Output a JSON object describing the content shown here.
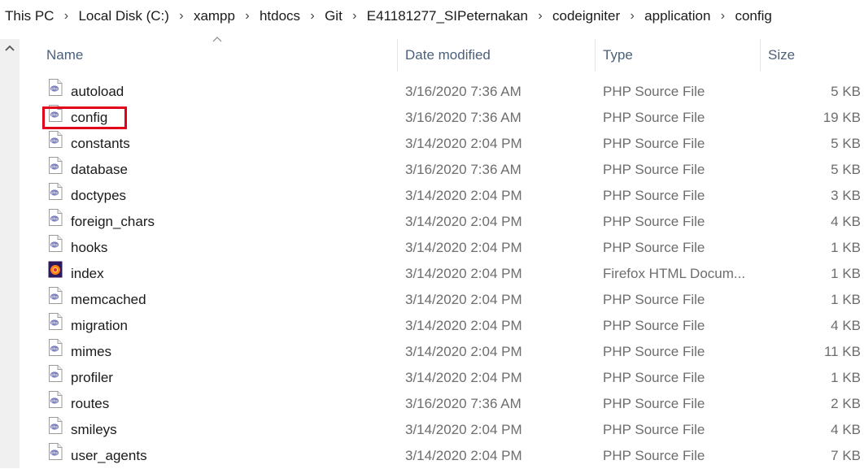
{
  "breadcrumb": [
    "This PC",
    "Local Disk (C:)",
    "xampp",
    "htdocs",
    "Git",
    "E41181277_SIPeternakan",
    "codeigniter",
    "application",
    "config"
  ],
  "columns": {
    "name": "Name",
    "date": "Date modified",
    "type": "Type",
    "size": "Size"
  },
  "files": [
    {
      "name": "autoload",
      "date": "3/16/2020 7:36 AM",
      "type": "PHP Source File",
      "size": "5 KB",
      "icon": "php-file-icon"
    },
    {
      "name": "config",
      "date": "3/16/2020 7:36 AM",
      "type": "PHP Source File",
      "size": "19 KB",
      "icon": "php-file-icon",
      "highlighted": true
    },
    {
      "name": "constants",
      "date": "3/14/2020 2:04 PM",
      "type": "PHP Source File",
      "size": "5 KB",
      "icon": "php-file-icon"
    },
    {
      "name": "database",
      "date": "3/16/2020 7:36 AM",
      "type": "PHP Source File",
      "size": "5 KB",
      "icon": "php-file-icon"
    },
    {
      "name": "doctypes",
      "date": "3/14/2020 2:04 PM",
      "type": "PHP Source File",
      "size": "3 KB",
      "icon": "php-file-icon"
    },
    {
      "name": "foreign_chars",
      "date": "3/14/2020 2:04 PM",
      "type": "PHP Source File",
      "size": "4 KB",
      "icon": "php-file-icon"
    },
    {
      "name": "hooks",
      "date": "3/14/2020 2:04 PM",
      "type": "PHP Source File",
      "size": "1 KB",
      "icon": "php-file-icon"
    },
    {
      "name": "index",
      "date": "3/14/2020 2:04 PM",
      "type": "Firefox HTML Docum...",
      "size": "1 KB",
      "icon": "firefox-html-icon"
    },
    {
      "name": "memcached",
      "date": "3/14/2020 2:04 PM",
      "type": "PHP Source File",
      "size": "1 KB",
      "icon": "php-file-icon"
    },
    {
      "name": "migration",
      "date": "3/14/2020 2:04 PM",
      "type": "PHP Source File",
      "size": "4 KB",
      "icon": "php-file-icon"
    },
    {
      "name": "mimes",
      "date": "3/14/2020 2:04 PM",
      "type": "PHP Source File",
      "size": "11 KB",
      "icon": "php-file-icon"
    },
    {
      "name": "profiler",
      "date": "3/14/2020 2:04 PM",
      "type": "PHP Source File",
      "size": "1 KB",
      "icon": "php-file-icon"
    },
    {
      "name": "routes",
      "date": "3/16/2020 7:36 AM",
      "type": "PHP Source File",
      "size": "2 KB",
      "icon": "php-file-icon"
    },
    {
      "name": "smileys",
      "date": "3/14/2020 2:04 PM",
      "type": "PHP Source File",
      "size": "4 KB",
      "icon": "php-file-icon"
    },
    {
      "name": "user_agents",
      "date": "3/14/2020 2:04 PM",
      "type": "PHP Source File",
      "size": "7 KB",
      "icon": "php-file-icon"
    }
  ],
  "colors": {
    "highlight": "#e0001a",
    "header_text": "#4c607a",
    "secondary_text": "#6d6d6d"
  }
}
